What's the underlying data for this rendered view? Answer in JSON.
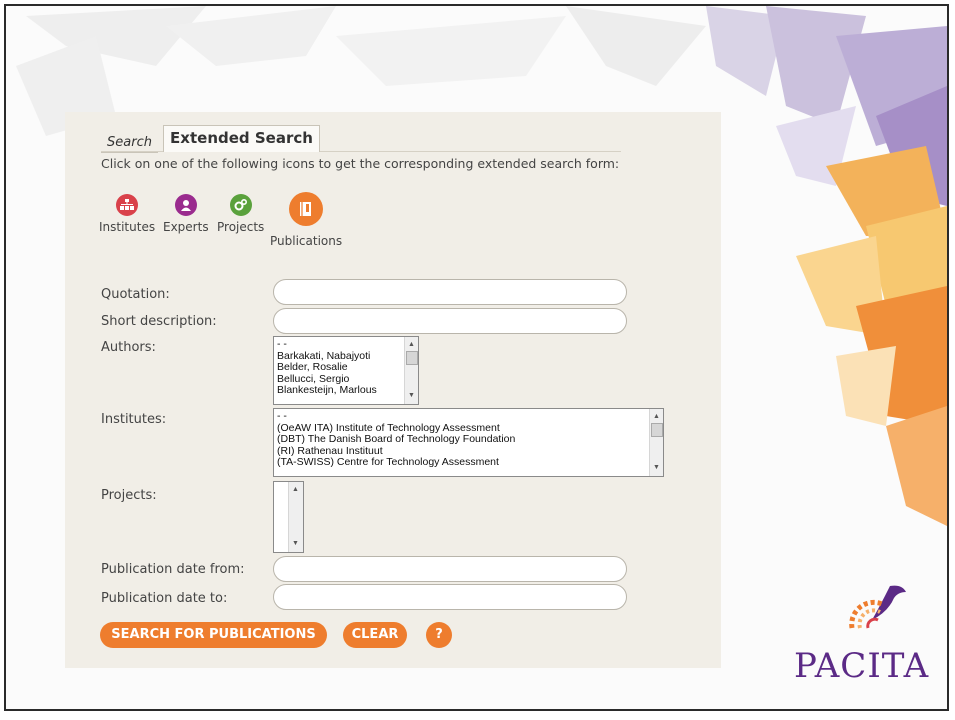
{
  "tabs": {
    "search": "Search",
    "extended": "Extended Search"
  },
  "instructions": "Click on one of the following icons to get the corresponding extended search form:",
  "categories": [
    {
      "label": "Institutes",
      "icon": "sitemap-icon",
      "color": "#d9414a"
    },
    {
      "label": "Experts",
      "icon": "person-icon",
      "color": "#9a2b8e"
    },
    {
      "label": "Projects",
      "icon": "gears-icon",
      "color": "#5aa13c"
    },
    {
      "label": "Publications",
      "icon": "book-icon",
      "color": "#ee7d2e"
    }
  ],
  "form": {
    "quotation_label": "Quotation:",
    "short_description_label": "Short description:",
    "authors_label": "Authors:",
    "authors_options": [
      "- -",
      "Barkakati, Nabajyoti",
      "Belder, Rosalie",
      "Bellucci, Sergio",
      "Blankesteijn, Marlous"
    ],
    "institutes_label": "Institutes:",
    "institutes_options": [
      "- -",
      "(OeAW ITA) Institute of Technology Assessment",
      "(DBT) The Danish Board of Technology Foundation",
      "(RI) Rathenau Instituut",
      "(TA-SWISS) Centre for Technology Assessment"
    ],
    "projects_label": "Projects:",
    "date_from_label": "Publication date from:",
    "date_to_label": "Publication date to:"
  },
  "buttons": {
    "search": "SEARCH FOR PUBLICATIONS",
    "clear": "CLEAR",
    "help": "?"
  },
  "brand": {
    "name": "PACITA",
    "color": "#5b2a86",
    "accent": "#ee7d2e"
  }
}
